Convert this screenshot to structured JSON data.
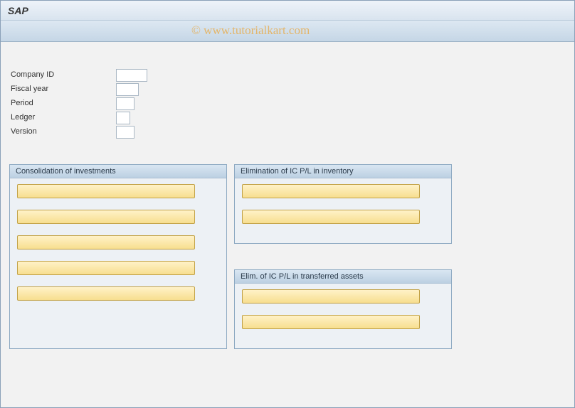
{
  "window": {
    "title": "SAP"
  },
  "watermark": "© www.tutorialkart.com",
  "fields": {
    "company_id": {
      "label": "Company ID",
      "value": ""
    },
    "fiscal_year": {
      "label": "Fiscal year",
      "value": ""
    },
    "period": {
      "label": "Period",
      "value": ""
    },
    "ledger": {
      "label": "Ledger",
      "value": ""
    },
    "version": {
      "label": "Version",
      "value": ""
    }
  },
  "panels": {
    "consolidation": {
      "title": "Consolidation of investments",
      "buttons": [
        "",
        "",
        "",
        "",
        ""
      ]
    },
    "elim_inventory": {
      "title": "Elimination of IC P/L in inventory",
      "buttons": [
        "",
        ""
      ]
    },
    "elim_transferred": {
      "title": "Elim. of IC P/L in transferred assets",
      "buttons": [
        "",
        ""
      ]
    }
  }
}
